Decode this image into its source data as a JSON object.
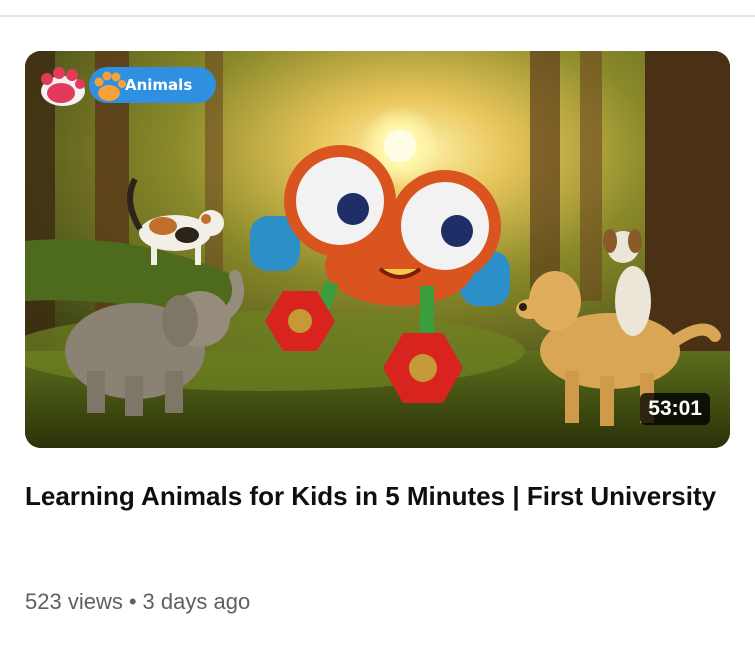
{
  "video": {
    "badge_label": "Animals",
    "duration": "53:01",
    "title": "Learning Animals for Kids in 5 Minutes | First University",
    "views": "523 views",
    "separator": "•",
    "age": "3 days ago"
  }
}
